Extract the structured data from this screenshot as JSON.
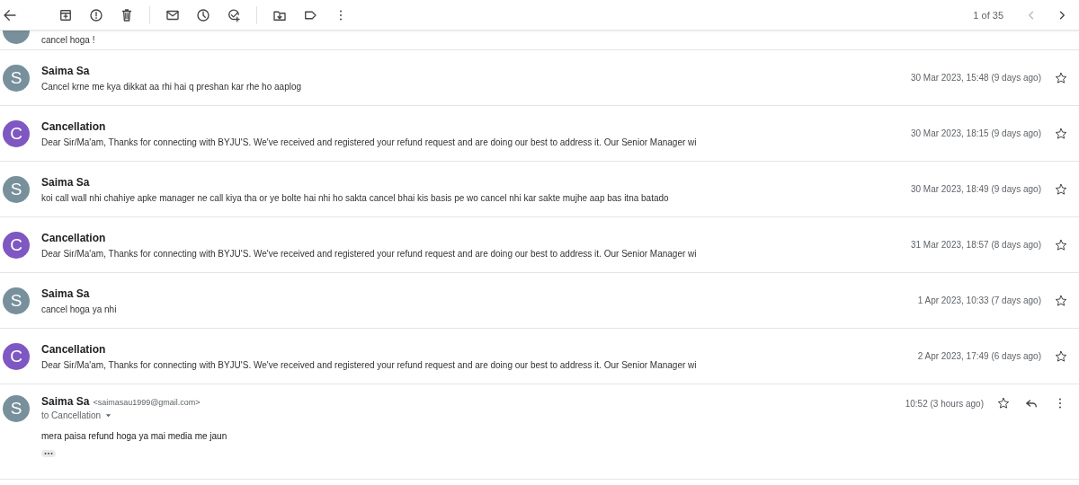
{
  "toolbar": {
    "page_count": "1 of 35"
  },
  "partial_message": {
    "snippet": "cancel hoga !",
    "color": "#78909c"
  },
  "messages": [
    {
      "avatar": "S",
      "color": "#78909c",
      "sender": "Saima Sa",
      "snippet": "Cancel krne me kya dikkat aa rhi hai q preshan kar rhe ho aaplog",
      "date": "30 Mar 2023, 15:48 (9 days ago)",
      "starred": false
    },
    {
      "avatar": "C",
      "color": "#7e57c2",
      "sender": "Cancellation",
      "snippet": "Dear Sir/Ma'am, Thanks for connecting with BYJU'S. We've received and registered your refund request and are doing our best to address it. Our Senior Manager wi",
      "date": "30 Mar 2023, 18:15 (9 days ago)",
      "starred": false
    },
    {
      "avatar": "S",
      "color": "#78909c",
      "sender": "Saima Sa",
      "snippet": "koi call wall nhi chahiye apke manager ne call kiya tha or ye bolte hai nhi ho sakta cancel bhai kis basis pe wo cancel nhi kar sakte mujhe aap bas itna batado",
      "date": "30 Mar 2023, 18:49 (9 days ago)",
      "starred": false
    },
    {
      "avatar": "C",
      "color": "#7e57c2",
      "sender": "Cancellation",
      "snippet": "Dear Sir/Ma'am, Thanks for connecting with BYJU'S. We've received and registered your refund request and are doing our best to address it. Our Senior Manager wi",
      "date": "31 Mar 2023, 18:57 (8 days ago)",
      "starred": false
    },
    {
      "avatar": "S",
      "color": "#78909c",
      "sender": "Saima Sa",
      "snippet": "cancel hoga ya nhi",
      "date": "1 Apr 2023, 10:33 (7 days ago)",
      "starred": false
    },
    {
      "avatar": "C",
      "color": "#7e57c2",
      "sender": "Cancellation",
      "snippet": "Dear Sir/Ma'am, Thanks for connecting with BYJU'S. We've received and registered your refund request and are doing our best to address it. Our Senior Manager wi",
      "date": "2 Apr 2023, 17:49 (6 days ago)",
      "starred": false
    }
  ],
  "open_message": {
    "avatar": "S",
    "color": "#78909c",
    "sender": "Saima Sa",
    "email": "<saimasau1999@gmail.com>",
    "recipient": "to Cancellation",
    "date": "10:52 (3 hours ago)",
    "starred": false,
    "body": "mera paisa refund hoga ya mai media me jaun"
  }
}
